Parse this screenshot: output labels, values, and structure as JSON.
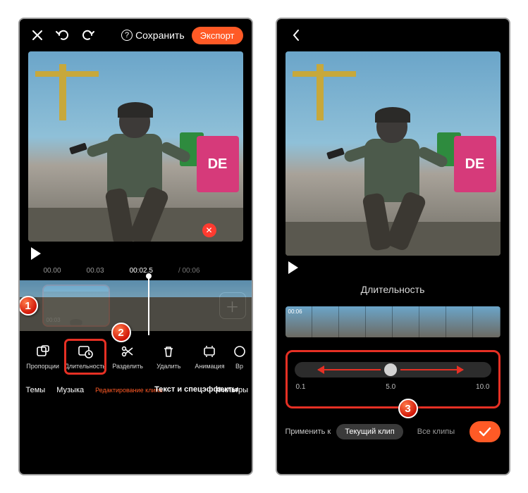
{
  "left": {
    "topbar": {
      "save": "Сохранить",
      "export": "Экспорт"
    },
    "timecodes": {
      "t1": "00.00",
      "t2": "00.03",
      "current": "00:02.5",
      "total": "/ 00:06"
    },
    "clip_duration": "00:03",
    "tools": {
      "proportions": "Пропорции",
      "duration": "Длительность",
      "split": "Разделить",
      "delete": "Удалить",
      "animation": "Анимация",
      "time_cut": "Вр"
    },
    "tabs": {
      "themes": "Темы",
      "music": "Музыка",
      "edit_clip": "Редактирование клипа",
      "text_fx": "Текст и спецэффекты",
      "filters": "Фильтры"
    },
    "callouts": {
      "one": "1",
      "two": "2"
    }
  },
  "right": {
    "title": "Длительность",
    "filmstrip_num": "00:06",
    "slider": {
      "min": "0.1",
      "mid": "5.0",
      "max": "10.0"
    },
    "apply": {
      "label": "Применить к",
      "current": "Текущий клип",
      "all": "Все клипы"
    },
    "callouts": {
      "three": "3"
    }
  }
}
